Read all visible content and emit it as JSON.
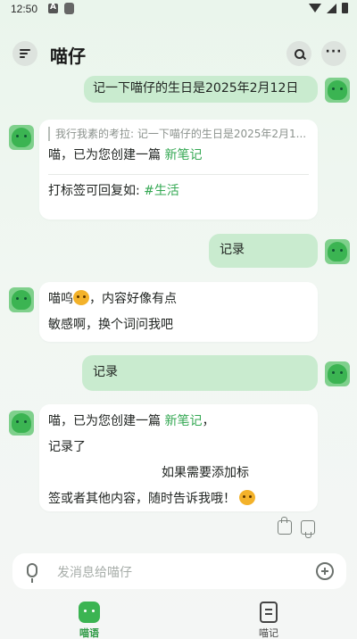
{
  "status_bar": {
    "time": "12:50"
  },
  "header": {
    "title": "喵仔"
  },
  "messages": [
    {
      "role": "user",
      "text": "记一下喵仔的生日是2025年2月12日"
    },
    {
      "role": "bot",
      "quote": "我行我素的考拉: 记一下喵仔的生日是2025年2月1...",
      "line1_prefix": "喵，已为您创建一篇 ",
      "line1_link": "新笔记",
      "line2_prefix": "打标签可回复如: ",
      "line2_link": "#生活"
    },
    {
      "role": "user",
      "text": "记录"
    },
    {
      "role": "bot",
      "line1_prefix": "喵呜",
      "line1_suffix": "，内容好像有点",
      "line2": "敏感啊，换个词问我吧"
    },
    {
      "role": "user",
      "text": "记录"
    },
    {
      "role": "bot",
      "line1_prefix": "喵，已为您创建一篇 ",
      "line1_link": "新笔记",
      "line1_suffix": "，",
      "line2": "记录了",
      "line3": "如果需要添加标",
      "line4": "签或者其他内容，随时告诉我哦！"
    }
  ],
  "input": {
    "placeholder": "发消息给喵仔"
  },
  "nav": [
    {
      "label": "喵语",
      "active": true
    },
    {
      "label": "喵记",
      "active": false
    }
  ],
  "icons": {
    "menu": "menu-icon",
    "search": "search-icon",
    "more": "more-icon",
    "mic": "mic-icon",
    "add": "plus-icon",
    "thumb_up": "thumb-up-icon",
    "thumb_down": "thumb-down-icon"
  },
  "colors": {
    "accent": "#34a853",
    "user_bubble": "#c9ebcf",
    "bot_bubble": "#ffffff"
  }
}
